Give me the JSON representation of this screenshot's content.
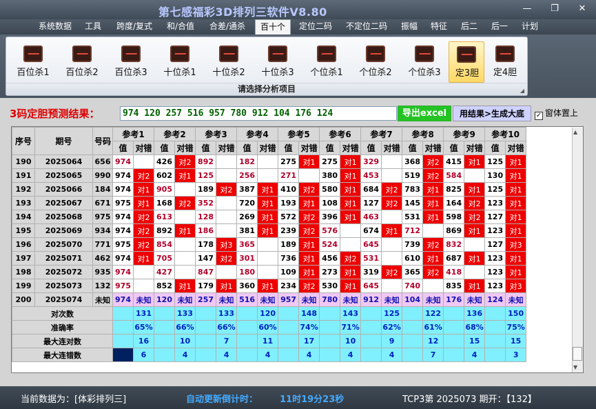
{
  "window": {
    "title": "第七感福彩3D排列三软件V8.80",
    "minimize": "—",
    "maximize": "❐",
    "close": "✕"
  },
  "menu": [
    "系统数据",
    "工具",
    "跨度/复式",
    "和/合值",
    "合差/通杀",
    "百十个",
    "定位二码",
    "不定位二码",
    "振幅",
    "特征",
    "后二",
    "后一",
    "计划"
  ],
  "menu_active": 5,
  "ribbon": {
    "items": [
      "百位杀1",
      "百位杀2",
      "百位杀3",
      "十位杀1",
      "十位杀2",
      "十位杀3",
      "个位杀1",
      "个位杀2",
      "个位杀3",
      "定3胆",
      "定4胆"
    ],
    "active": 9,
    "caption": "请选择分析项目"
  },
  "prediction": {
    "label": "3码定胆预测结果：",
    "value": "974 120 257 516 957 780 912 104 176 124",
    "excel_button": "导出excel",
    "generate_button": "用结果>生成大底",
    "ontop_label": "窗体置上",
    "ontop_checked": "✓"
  },
  "table": {
    "headers": {
      "seq": "序号",
      "period": "期号",
      "number": "号码",
      "value": "值",
      "result": "对错"
    },
    "refs": [
      "参考1",
      "参考2",
      "参考3",
      "参考4",
      "参考5",
      "参考6",
      "参考7",
      "参考8",
      "参考9",
      "参考10"
    ],
    "rows": [
      {
        "seq": "190",
        "period": "2025064",
        "num": "656",
        "cells": [
          [
            "974",
            ""
          ],
          [
            "426",
            "对2"
          ],
          [
            "892",
            ""
          ],
          [
            "182",
            ""
          ],
          [
            "275",
            "对1"
          ],
          [
            "275",
            "对1"
          ],
          [
            "329",
            ""
          ],
          [
            "368",
            "对2"
          ],
          [
            "415",
            "对1"
          ],
          [
            "125",
            "对1"
          ]
        ]
      },
      {
        "seq": "191",
        "period": "2025065",
        "num": "990",
        "cells": [
          [
            "974",
            "对2"
          ],
          [
            "602",
            "对1"
          ],
          [
            "125",
            ""
          ],
          [
            "256",
            ""
          ],
          [
            "271",
            ""
          ],
          [
            "380",
            "对1"
          ],
          [
            "453",
            ""
          ],
          [
            "519",
            "对2"
          ],
          [
            "584",
            ""
          ],
          [
            "130",
            "对1"
          ]
        ]
      },
      {
        "seq": "192",
        "period": "2025066",
        "num": "184",
        "cells": [
          [
            "974",
            "对1"
          ],
          [
            "905",
            ""
          ],
          [
            "189",
            "对2"
          ],
          [
            "387",
            "对1"
          ],
          [
            "410",
            "对2"
          ],
          [
            "580",
            "对1"
          ],
          [
            "684",
            "对2"
          ],
          [
            "783",
            "对1"
          ],
          [
            "825",
            "对1"
          ],
          [
            "125",
            "对1"
          ]
        ]
      },
      {
        "seq": "193",
        "period": "2025067",
        "num": "671",
        "cells": [
          [
            "975",
            "对1"
          ],
          [
            "168",
            "对2"
          ],
          [
            "352",
            ""
          ],
          [
            "720",
            "对1"
          ],
          [
            "193",
            "对1"
          ],
          [
            "108",
            "对1"
          ],
          [
            "127",
            "对2"
          ],
          [
            "145",
            "对1"
          ],
          [
            "164",
            "对2"
          ],
          [
            "123",
            "对1"
          ]
        ]
      },
      {
        "seq": "194",
        "period": "2025068",
        "num": "975",
        "cells": [
          [
            "974",
            "对2"
          ],
          [
            "613",
            ""
          ],
          [
            "128",
            ""
          ],
          [
            "269",
            "对1"
          ],
          [
            "572",
            "对2"
          ],
          [
            "396",
            "对1"
          ],
          [
            "463",
            ""
          ],
          [
            "531",
            "对1"
          ],
          [
            "598",
            "对2"
          ],
          [
            "127",
            "对1"
          ]
        ]
      },
      {
        "seq": "195",
        "period": "2025069",
        "num": "934",
        "cells": [
          [
            "974",
            "对2"
          ],
          [
            "892",
            "对1"
          ],
          [
            "186",
            ""
          ],
          [
            "381",
            "对1"
          ],
          [
            "239",
            "对2"
          ],
          [
            "576",
            ""
          ],
          [
            "674",
            "对1"
          ],
          [
            "712",
            ""
          ],
          [
            "869",
            "对1"
          ],
          [
            "123",
            "对1"
          ]
        ]
      },
      {
        "seq": "196",
        "period": "2025070",
        "num": "771",
        "cells": [
          [
            "975",
            "对2"
          ],
          [
            "854",
            ""
          ],
          [
            "178",
            "对3"
          ],
          [
            "365",
            ""
          ],
          [
            "189",
            "对1"
          ],
          [
            "524",
            ""
          ],
          [
            "645",
            ""
          ],
          [
            "739",
            "对2"
          ],
          [
            "832",
            ""
          ],
          [
            "127",
            "对3"
          ]
        ]
      },
      {
        "seq": "197",
        "period": "2025071",
        "num": "462",
        "cells": [
          [
            "974",
            "对1"
          ],
          [
            "705",
            ""
          ],
          [
            "147",
            "对2"
          ],
          [
            "301",
            ""
          ],
          [
            "736",
            "对1"
          ],
          [
            "456",
            "对2"
          ],
          [
            "531",
            ""
          ],
          [
            "610",
            "对1"
          ],
          [
            "687",
            "对1"
          ],
          [
            "123",
            "对1"
          ]
        ]
      },
      {
        "seq": "198",
        "period": "2025072",
        "num": "935",
        "cells": [
          [
            "974",
            ""
          ],
          [
            "427",
            ""
          ],
          [
            "847",
            ""
          ],
          [
            "180",
            ""
          ],
          [
            "109",
            "对1"
          ],
          [
            "273",
            "对1"
          ],
          [
            "319",
            "对2"
          ],
          [
            "365",
            "对2"
          ],
          [
            "418",
            ""
          ],
          [
            "123",
            "对1"
          ]
        ]
      },
      {
        "seq": "199",
        "period": "2025073",
        "num": "132",
        "cells": [
          [
            "975",
            ""
          ],
          [
            "852",
            "对1"
          ],
          [
            "179",
            "对1"
          ],
          [
            "360",
            "对1"
          ],
          [
            "234",
            "对2"
          ],
          [
            "530",
            "对1"
          ],
          [
            "645",
            ""
          ],
          [
            "740",
            ""
          ],
          [
            "835",
            "对1"
          ],
          [
            "123",
            "对3"
          ]
        ]
      }
    ],
    "future": {
      "seq": "200",
      "period": "2025074",
      "num": "未知",
      "values": [
        "974",
        "120",
        "257",
        "516",
        "957",
        "780",
        "912",
        "104",
        "176",
        "124"
      ],
      "result": "未知"
    },
    "stats": [
      {
        "label": "对次数",
        "values": [
          "131",
          "133",
          "133",
          "120",
          "148",
          "143",
          "125",
          "122",
          "136",
          "150"
        ]
      },
      {
        "label": "准确率",
        "values": [
          "65%",
          "66%",
          "66%",
          "60%",
          "74%",
          "71%",
          "62%",
          "61%",
          "68%",
          "75%"
        ]
      },
      {
        "label": "最大连对数",
        "values": [
          "16",
          "10",
          "7",
          "11",
          "17",
          "10",
          "9",
          "12",
          "15",
          "15"
        ]
      },
      {
        "label": "最大连错数",
        "values": [
          "6",
          "4",
          "4",
          "4",
          "4",
          "4",
          "4",
          "7",
          "4",
          "3"
        ]
      }
    ]
  },
  "status": {
    "data_source": "当前数据为：[体彩排列三]",
    "timer_label": "自动更新倒计时：",
    "timer_value": "11时19分23秒",
    "draw": "TCP3第 2025073 期开：【132】"
  },
  "colors": {
    "hit": "#ee0000",
    "stat_bg": "#80f0ff",
    "future_bg": "#f0c8f4",
    "title_text": "#b9c8ff"
  }
}
